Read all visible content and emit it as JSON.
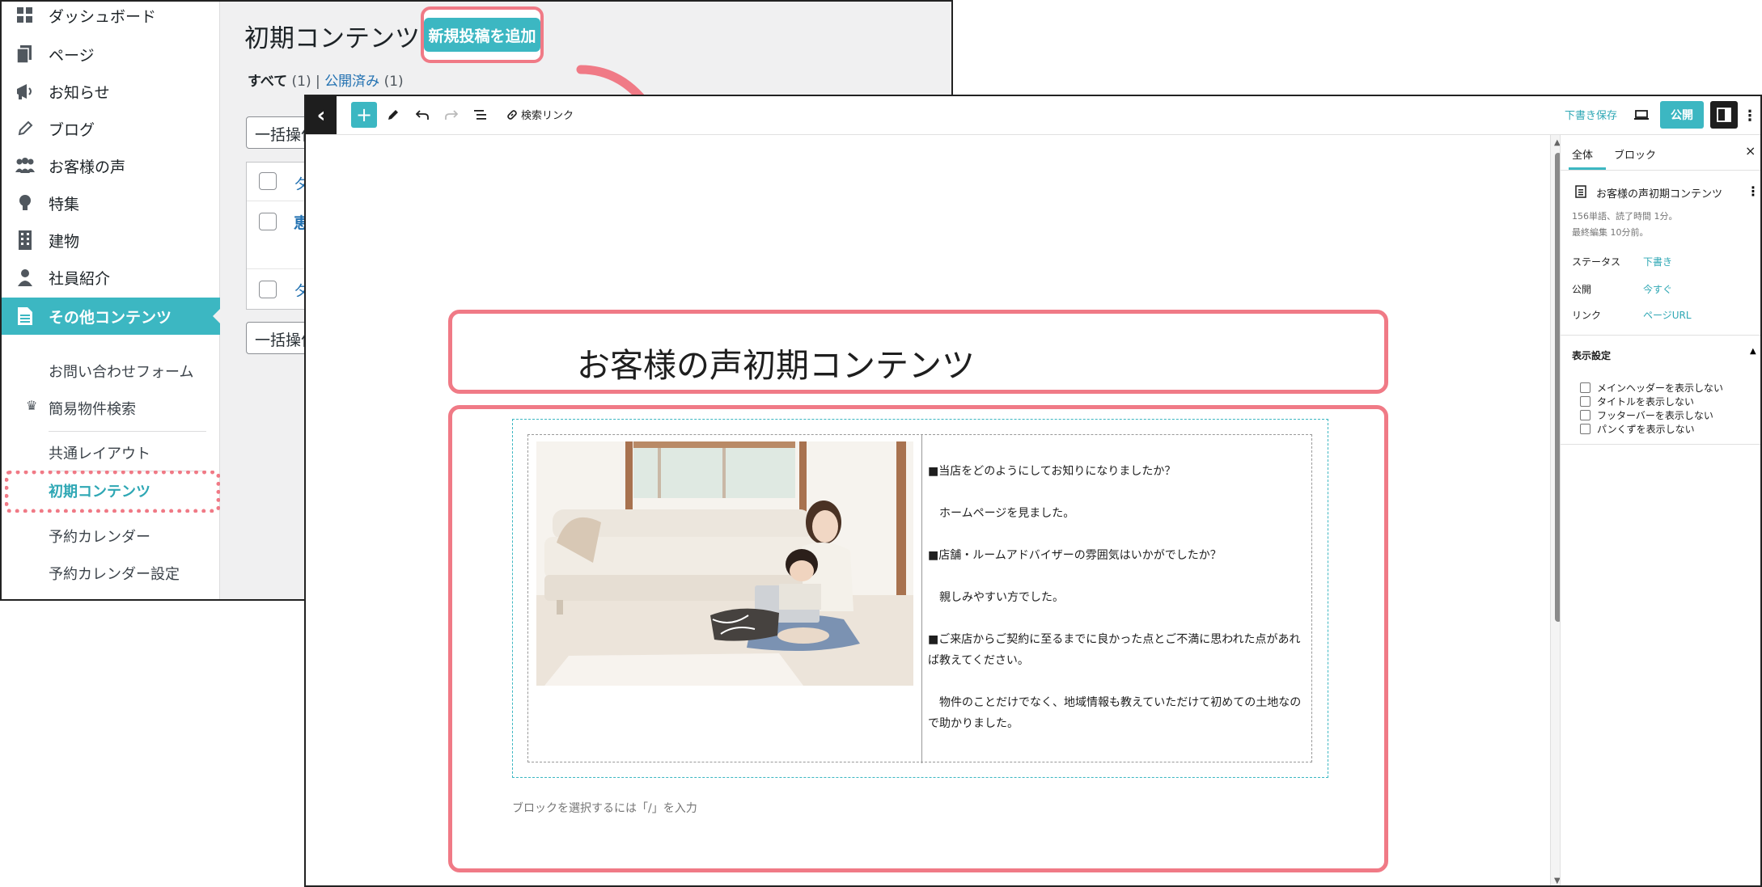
{
  "admin": {
    "sidebar": {
      "items": [
        {
          "label": "ダッシュボード",
          "icon": "dashboard-icon"
        },
        {
          "label": "ページ",
          "icon": "pages-icon"
        },
        {
          "label": "お知らせ",
          "icon": "megaphone-icon"
        },
        {
          "label": "ブログ",
          "icon": "pencil-icon"
        },
        {
          "label": "お客様の声",
          "icon": "groups-icon"
        },
        {
          "label": "特集",
          "icon": "lightbulb-icon"
        },
        {
          "label": "建物",
          "icon": "building-icon"
        },
        {
          "label": "社員紹介",
          "icon": "person-icon"
        },
        {
          "label": "その他コンテンツ",
          "icon": "document-icon"
        }
      ],
      "sub_items": {
        "contact_form": "お問い合わせフォーム",
        "simple_search": "簡易物件検索",
        "common_layout": "共通レイアウト",
        "initial_content": "初期コンテンツ",
        "reservation_calendar": "予約カレンダー",
        "reservation_calendar_settings": "予約カレンダー設定"
      }
    },
    "page_title": "初期コンテンツ",
    "add_new_button": "新規投稿を追加",
    "filters": {
      "all_label": "すべて",
      "all_count": "(1)",
      "separator": "|",
      "published_label": "公開済み",
      "published_count": "(1)"
    },
    "bulk_action": "一括操作",
    "rows": [
      "タ",
      "恵",
      "タ"
    ]
  },
  "editor": {
    "toolbar": {
      "back_icon": "chevron-left-icon",
      "search_link_label": "検索リンク",
      "save_draft": "下書き保存",
      "publish": "公開"
    },
    "post_title": "お客様の声初期コンテンツ",
    "qa": [
      "■当店をどのようにしてお知りになりましたか？",
      "　ホームページを見ました。",
      "■店舗・ルームアドバイザーの雰囲気はいかがでしたか？",
      "　親しみやすい方でした。",
      "■ご来店からご契約に至るまでに良かった点とご不満に思われた点があれば教えてください。",
      "　物件のことだけでなく、地域情報も教えていただけて初めての土地なので助かりました。"
    ],
    "block_placeholder": "ブロックを選択するには「/」を入力",
    "panel": {
      "tab_post": "全体",
      "tab_block": "ブロック",
      "close": "×",
      "doc_title": "お客様の声初期コンテンツ",
      "meta_words": "156単語、読了時間 1分。",
      "meta_edited": "最終編集 10分前。",
      "status_label": "ステータス",
      "status_value": "下書き",
      "publish_label": "公開",
      "publish_value": "今すぐ",
      "link_label": "リンク",
      "link_value": "ページURL",
      "display_section": "表示設定",
      "checks": [
        "メインヘッダーを表示しない",
        "タイトルを表示しない",
        "フッターバーを表示しない",
        "パンくずを表示しない"
      ]
    }
  },
  "colors": {
    "accent": "#3cb7c2",
    "highlight": "#f07a86",
    "link": "#2271b1"
  }
}
